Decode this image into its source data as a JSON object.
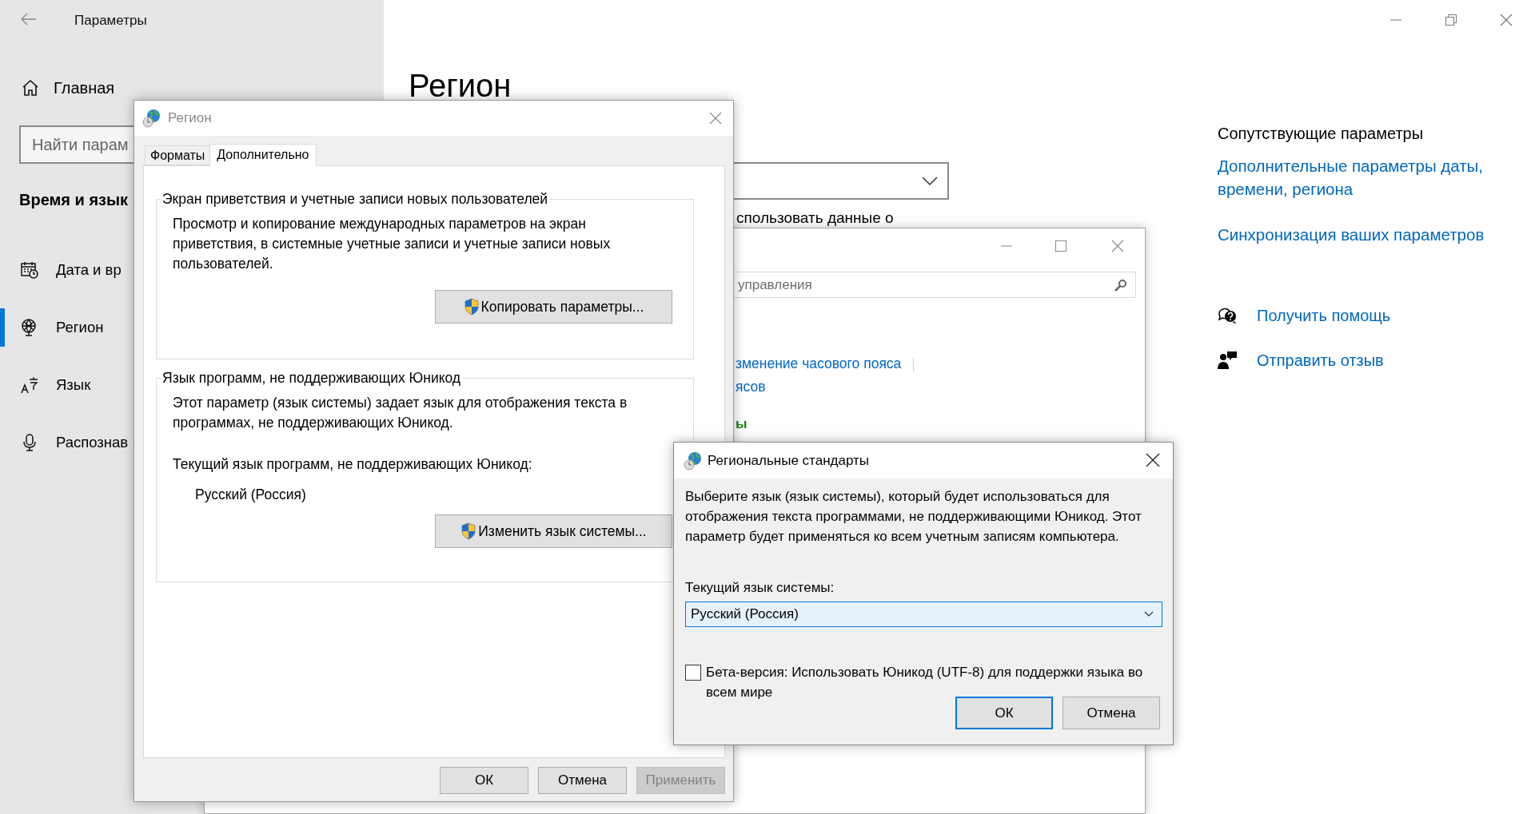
{
  "settings_window": {
    "title": "Параметры",
    "sidebar": {
      "home": "Главная",
      "search": {
        "placeholder": "Найти парам"
      },
      "section": "Время и язык",
      "items": [
        {
          "kind": "calendar",
          "label": "Дата и вр",
          "selected": false
        },
        {
          "kind": "globe",
          "label": "Регион",
          "selected": true
        },
        {
          "kind": "language",
          "label": "Язык",
          "selected": false
        },
        {
          "kind": "microphone",
          "label": "Распознав",
          "selected": false
        }
      ]
    },
    "page": {
      "heading": "Регион",
      "partial_text": "спользовать данные о"
    },
    "related": {
      "title": "Сопутствующие параметры",
      "links": [
        "Дополнительные параметры даты, времени, региона",
        "Синхронизация ваших параметров"
      ]
    },
    "support": [
      {
        "kind": "help",
        "label": "Получить помощь"
      },
      {
        "kind": "feedback",
        "label": "Отправить отзыв"
      }
    ]
  },
  "control_panel": {
    "search": {
      "placeholder": "управления"
    },
    "links": [
      "зменение часового пояса",
      "ясов"
    ],
    "heading": "ы"
  },
  "region_dialog": {
    "title": "Регион",
    "active": false,
    "tabs": [
      {
        "label": "Форматы",
        "selected": false
      },
      {
        "label": "Дополнительно",
        "selected": true
      }
    ],
    "groups": [
      {
        "title": "Экран приветствия и учетные записи новых пользователей",
        "text": "Просмотр и копирование международных параметров на экран приветствия, в системные учетные записи и учетные записи новых пользователей.",
        "button": "Копировать параметры..."
      },
      {
        "title": "Язык программ, не поддерживающих Юникод",
        "text": "Этот параметр (язык системы) задает язык для отображения текста в программах, не поддерживающих Юникод.",
        "current_label": "Текущий язык программ, не поддерживающих Юникод:",
        "current_value": "Русский (Россия)",
        "button": "Изменить язык системы..."
      }
    ],
    "buttons": [
      {
        "label": "ОК",
        "disabled": false
      },
      {
        "label": "Отмена",
        "disabled": false
      },
      {
        "label": "Применить",
        "disabled": true
      }
    ]
  },
  "locale_dialog": {
    "title": "Региональные стандарты",
    "active": true,
    "text": "Выберите язык (язык системы), который будет использоваться для отображения текста программами, не поддерживающими Юникод. Этот параметр будет применяться ко всем учетным записям компьютера.",
    "label": "Текущий язык системы:",
    "select": {
      "value": "Русский (Россия)"
    },
    "beta": {
      "label": "Бета-версия: Использовать Юникод (UTF-8) для поддержки языка во всем мире",
      "checked": false
    },
    "buttons": [
      {
        "label": "ОК",
        "default": true
      },
      {
        "label": "Отмена",
        "default": false
      }
    ]
  }
}
